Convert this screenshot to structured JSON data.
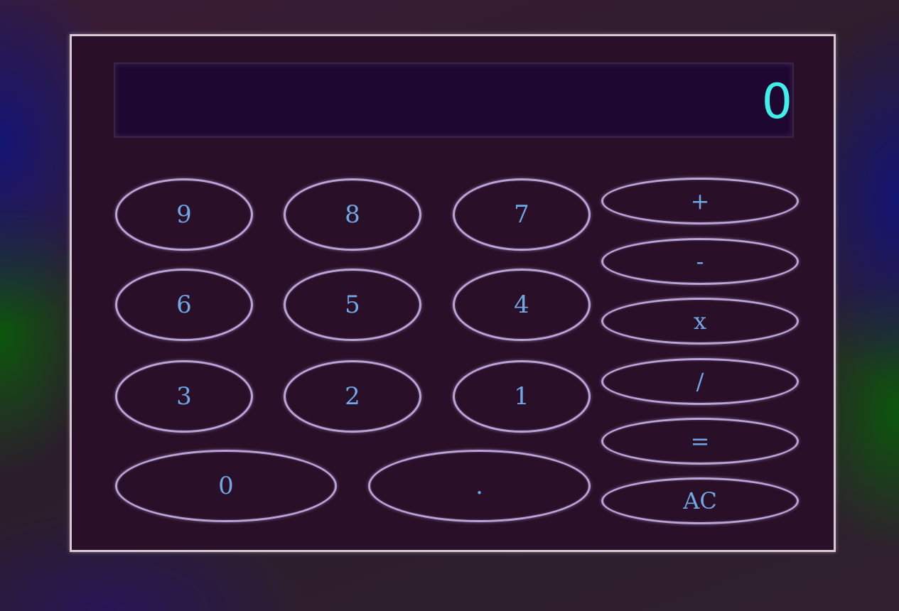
{
  "display": {
    "value": "0"
  },
  "keys": {
    "digits": [
      "9",
      "8",
      "7",
      "6",
      "5",
      "4",
      "3",
      "2",
      "1"
    ],
    "zero": "0",
    "decimal": "."
  },
  "operators": {
    "plus": "+",
    "minus": "-",
    "multiply": "x",
    "divide": "/",
    "equals": "=",
    "clear": "AC"
  },
  "colors": {
    "panel": "#2a0f28",
    "display_bg": "#1e0730",
    "display_text": "#3ff0ea",
    "key_border": "#b9a4d8",
    "key_text": "#70a8e4"
  }
}
